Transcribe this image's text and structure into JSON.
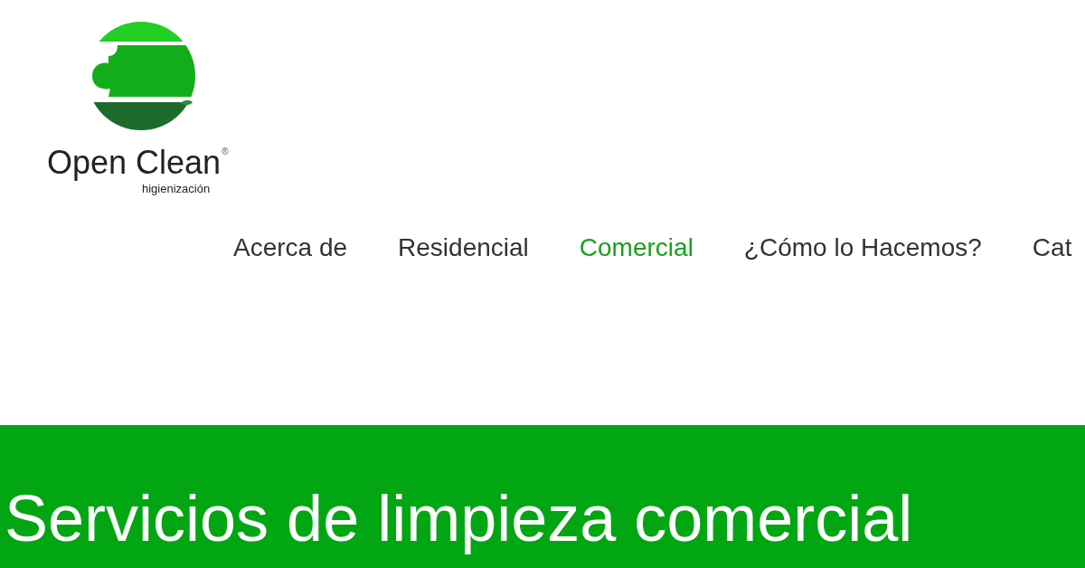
{
  "logo": {
    "name": "Open Clean",
    "registered_mark": "®",
    "tagline": "higienización"
  },
  "nav": [
    {
      "label": "Acerca de",
      "selected": false
    },
    {
      "label": "Residencial",
      "selected": false
    },
    {
      "label": "Comercial",
      "selected": true
    },
    {
      "label": "¿Cómo lo Hacemos?",
      "selected": false
    },
    {
      "label": "Cat",
      "selected": false
    }
  ],
  "hero": {
    "title": "Servicios de limpieza comercial"
  }
}
